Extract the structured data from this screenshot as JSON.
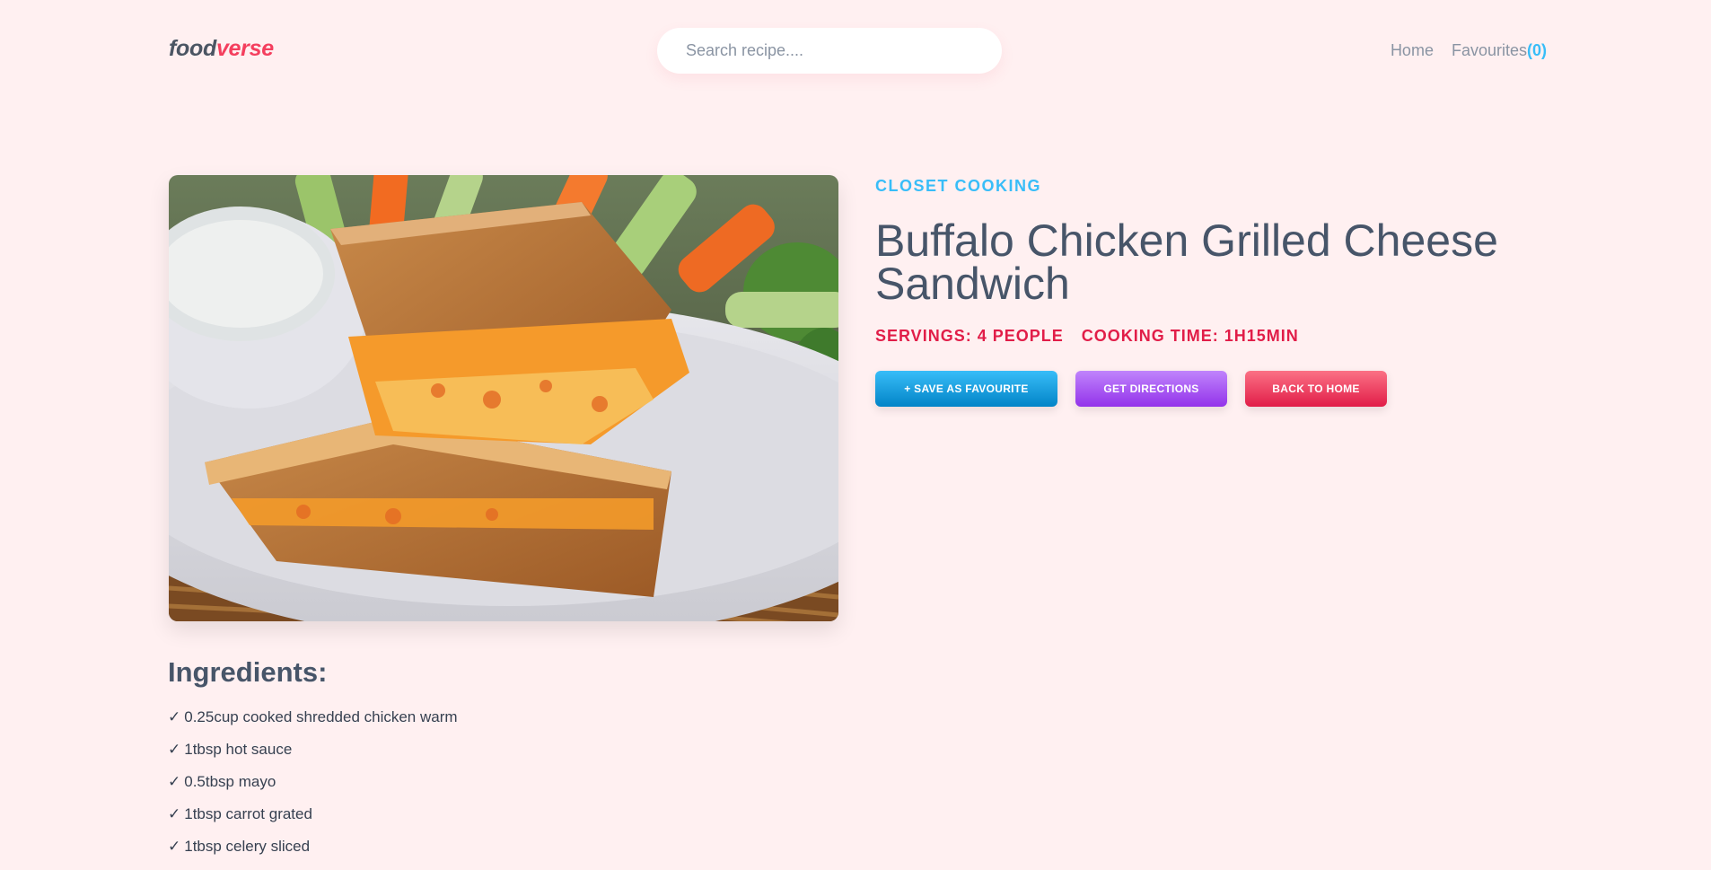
{
  "header": {
    "logo_part1": "food",
    "logo_part2": "verse",
    "search_placeholder": "Search recipe....",
    "nav_home": "Home",
    "nav_favourites": "Favourites",
    "nav_favourites_count": "(0)"
  },
  "recipe": {
    "publisher": "CLOSET COOKING",
    "title": "Buffalo Chicken Grilled Cheese Sandwich",
    "servings": "SERVINGS: 4 PEOPLE",
    "cooking_time": "COOKING TIME: 1H15MIN",
    "buttons": {
      "save_favourite": "+ SAVE AS FAVOURITE",
      "get_directions": "GET DIRECTIONS",
      "back_home": "BACK TO HOME"
    },
    "image_icon": "food-photo"
  },
  "ingredients": {
    "heading": "Ingredients:",
    "check_symbol": "✓",
    "items": [
      "0.25cup cooked shredded chicken warm",
      "1tbsp hot sauce",
      "0.5tbsp mayo",
      "1tbsp carrot grated",
      "1tbsp celery sliced"
    ]
  },
  "colors": {
    "background": "#fff0f1",
    "accent_pink": "#f43f5e",
    "accent_blue": "#38bdf8",
    "accent_purple": "#9333ea",
    "text": "#475569"
  }
}
